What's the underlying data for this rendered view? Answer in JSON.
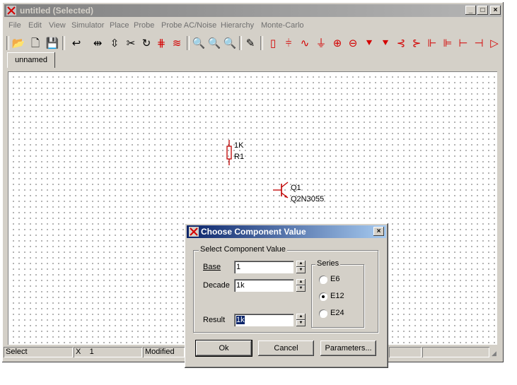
{
  "window": {
    "title": "untitled (Selected)",
    "controls": {
      "minimize": "_",
      "maximize": "□",
      "close": "×"
    }
  },
  "menu": [
    "File",
    "Edit",
    "View",
    "Simulator",
    "Place",
    "Probe",
    "Probe AC/Noise",
    "Hierarchy",
    "Monte-Carlo"
  ],
  "tabs": [
    "unnamed"
  ],
  "schematic": {
    "resistor": {
      "value": "1K",
      "ref": "R1"
    },
    "transistor": {
      "ref": "Q1",
      "model": "Q2N3055"
    }
  },
  "status": {
    "mode": "Select",
    "x_label": "X",
    "x_value": "1",
    "modified": "Modified"
  },
  "dialog": {
    "title": "Choose Component Value",
    "group_label": "Select Component Value",
    "base_label": "Base",
    "base_value": "1",
    "decade_label": "Decade",
    "decade_value": "1k",
    "result_label": "Result",
    "result_value": "1k",
    "series_label": "Series",
    "series_options": [
      "E6",
      "E12",
      "E24"
    ],
    "series_selected": "E12",
    "ok_label": "Ok",
    "cancel_label": "Cancel",
    "parameters_label": "Parameters..."
  }
}
